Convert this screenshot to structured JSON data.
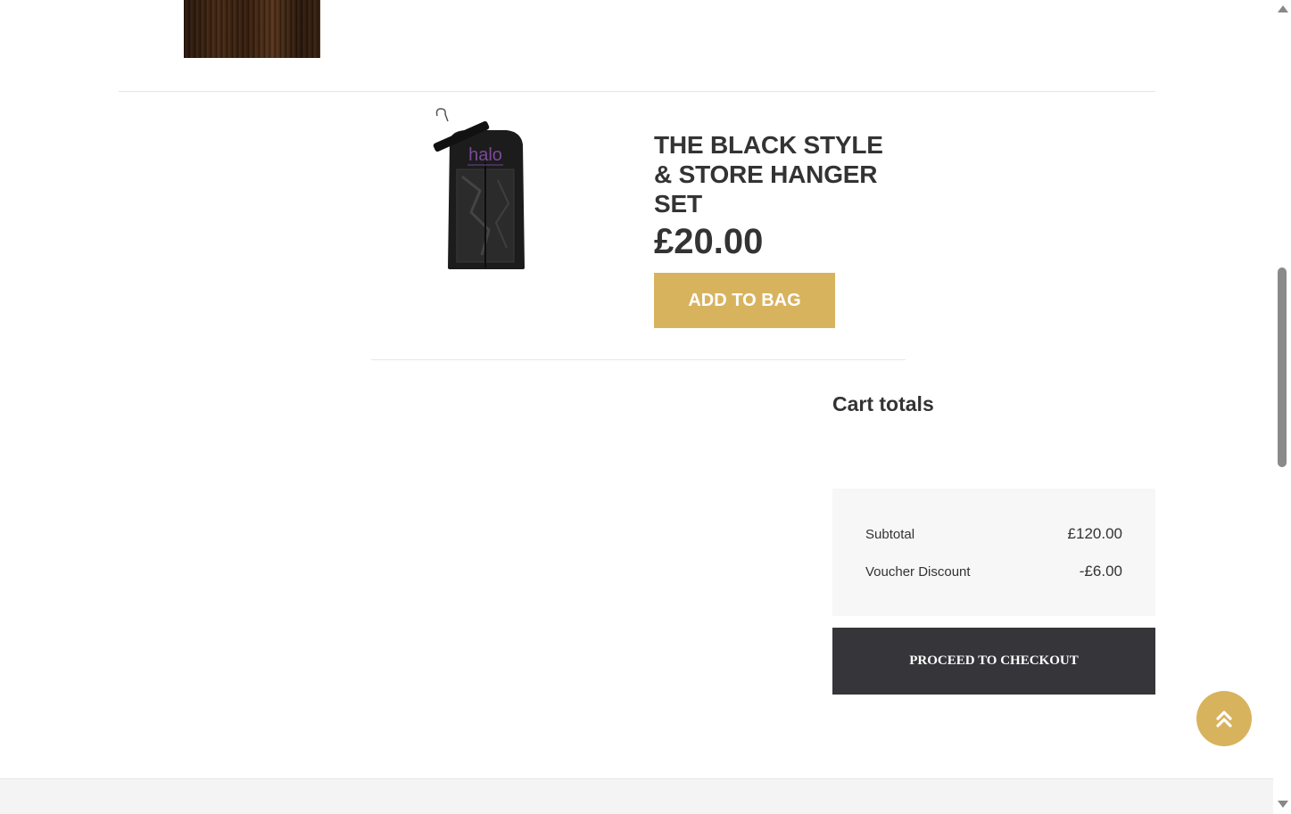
{
  "product": {
    "title": "THE BLACK STYLE & STORE HANGER SET",
    "price": "£20.00",
    "add_to_bag_label": "ADD TO BAG",
    "image_brand_text": "halo"
  },
  "cart_totals": {
    "title": "Cart totals",
    "rows": [
      {
        "label": "Subtotal",
        "value": "£120.00"
      },
      {
        "label": "Voucher Discount",
        "value": "-£6.00"
      }
    ],
    "checkout_label": "PROCEED TO CHECKOUT"
  },
  "colors": {
    "accent_gold": "#d8b35e",
    "checkout_dark": "#35353a",
    "text_dark": "#333333"
  },
  "icons": {
    "back_to_top": "double-chevron-up-icon"
  }
}
